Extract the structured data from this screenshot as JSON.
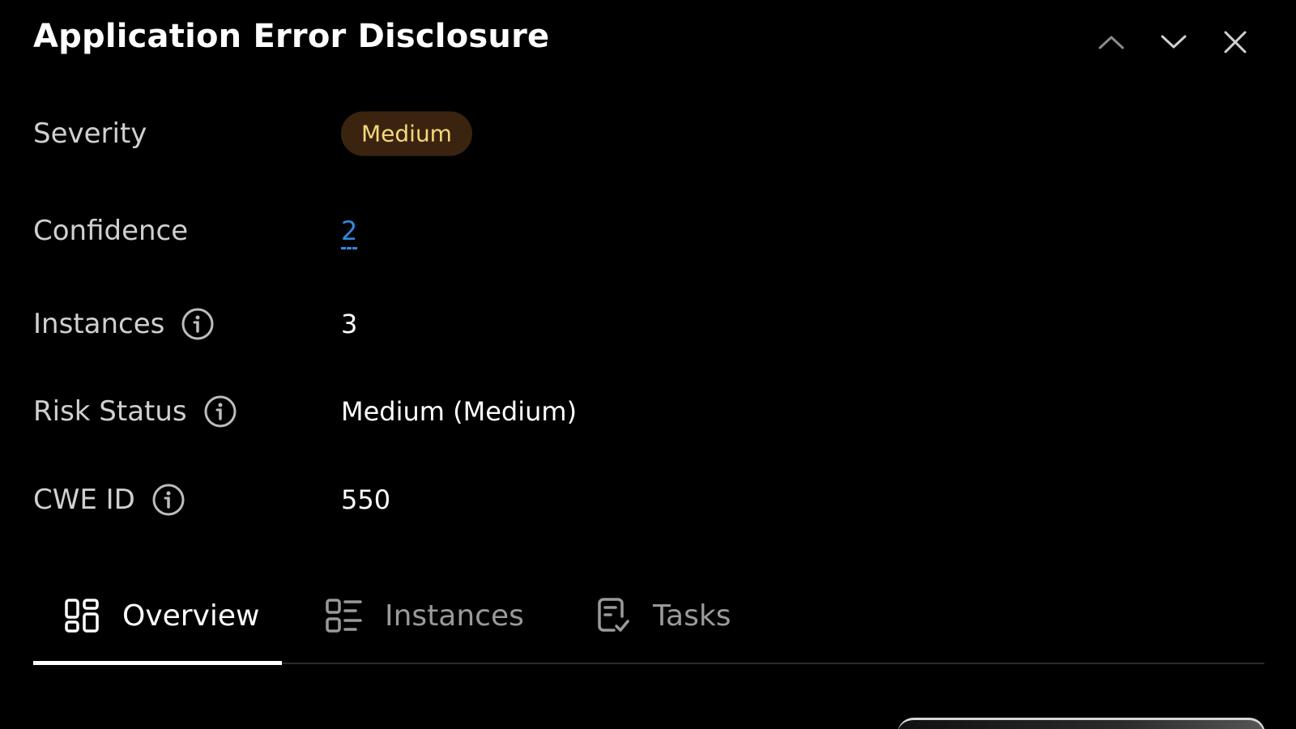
{
  "header": {
    "title": "Application Error Disclosure",
    "prev_icon": "chevron-up-icon",
    "next_icon": "chevron-down-icon",
    "close_icon": "close-icon"
  },
  "details": {
    "severity": {
      "label": "Severity",
      "value": "Medium",
      "badge_bg": "#3a2410",
      "badge_fg": "#f6d77a"
    },
    "confidence": {
      "label": "Confidence",
      "value": "2",
      "link_color": "#2f8ae0"
    },
    "instances": {
      "label": "Instances",
      "value": "3",
      "icon": "info-icon"
    },
    "risk_status": {
      "label": "Risk Status",
      "value": "Medium (Medium)",
      "icon": "info-icon"
    },
    "cwe_id": {
      "label": "CWE ID",
      "value": "550",
      "icon": "info-icon"
    }
  },
  "tabs": [
    {
      "label": "Overview",
      "icon": "overview-grid-icon",
      "active": true
    },
    {
      "label": "Instances",
      "icon": "list-icon",
      "active": false
    },
    {
      "label": "Tasks",
      "icon": "task-check-icon",
      "active": false
    }
  ]
}
